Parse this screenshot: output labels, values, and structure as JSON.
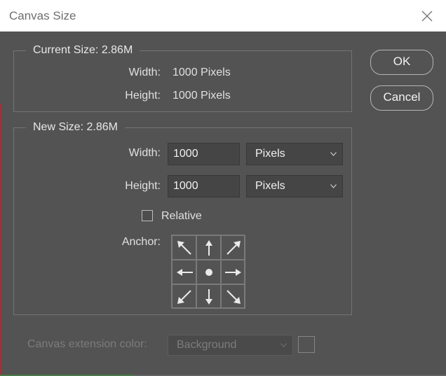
{
  "window": {
    "title": "Canvas Size"
  },
  "current_size": {
    "legend": "Current Size: 2.86M",
    "width_label": "Width:",
    "width_value": "1000 Pixels",
    "height_label": "Height:",
    "height_value": "1000 Pixels"
  },
  "new_size": {
    "legend": "New Size: 2.86M",
    "width_label": "Width:",
    "width_value": "1000",
    "width_unit": "Pixels",
    "height_label": "Height:",
    "height_value": "1000",
    "height_unit": "Pixels",
    "relative_label": "Relative",
    "relative_checked": false,
    "anchor_label": "Anchor:",
    "anchor_icons": [
      "arrow-up-left-icon",
      "arrow-up-icon",
      "arrow-up-right-icon",
      "arrow-left-icon",
      "center-dot-icon",
      "arrow-right-icon",
      "arrow-down-left-icon",
      "arrow-down-icon",
      "arrow-down-right-icon"
    ]
  },
  "buttons": {
    "ok": "OK",
    "cancel": "Cancel"
  },
  "extension": {
    "label": "Canvas extension color:",
    "value": "Background"
  },
  "colors": {
    "dialog_bg": "#535353",
    "titlebar_bg": "#ffffff",
    "accent_edge": "#b8272f"
  }
}
